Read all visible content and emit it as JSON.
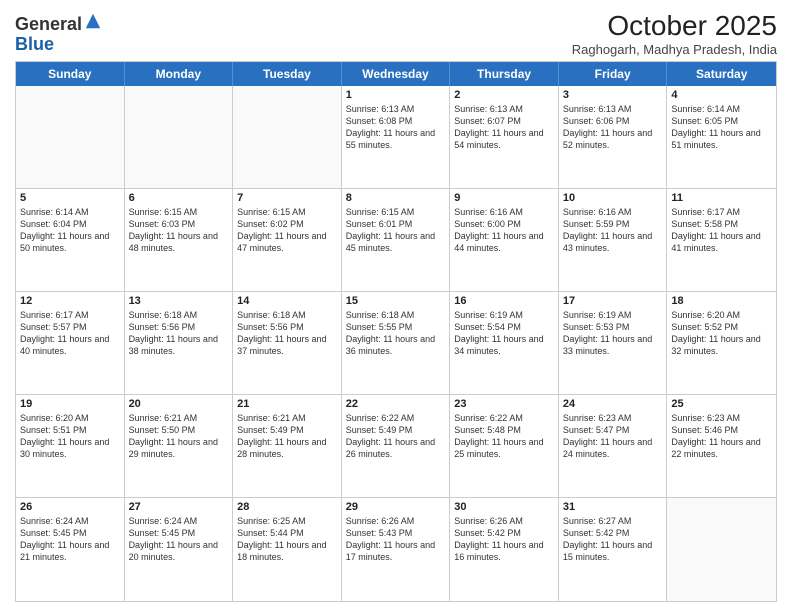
{
  "header": {
    "logo_general": "General",
    "logo_blue": "Blue",
    "month_title": "October 2025",
    "subtitle": "Raghogarh, Madhya Pradesh, India"
  },
  "calendar": {
    "days_of_week": [
      "Sunday",
      "Monday",
      "Tuesday",
      "Wednesday",
      "Thursday",
      "Friday",
      "Saturday"
    ],
    "weeks": [
      [
        {
          "day": "",
          "empty": true
        },
        {
          "day": "",
          "empty": true
        },
        {
          "day": "",
          "empty": true
        },
        {
          "day": "1",
          "sunrise": "6:13 AM",
          "sunset": "6:08 PM",
          "daylight": "11 hours and 55 minutes."
        },
        {
          "day": "2",
          "sunrise": "6:13 AM",
          "sunset": "6:07 PM",
          "daylight": "11 hours and 54 minutes."
        },
        {
          "day": "3",
          "sunrise": "6:13 AM",
          "sunset": "6:06 PM",
          "daylight": "11 hours and 52 minutes."
        },
        {
          "day": "4",
          "sunrise": "6:14 AM",
          "sunset": "6:05 PM",
          "daylight": "11 hours and 51 minutes."
        }
      ],
      [
        {
          "day": "5",
          "sunrise": "6:14 AM",
          "sunset": "6:04 PM",
          "daylight": "11 hours and 50 minutes."
        },
        {
          "day": "6",
          "sunrise": "6:15 AM",
          "sunset": "6:03 PM",
          "daylight": "11 hours and 48 minutes."
        },
        {
          "day": "7",
          "sunrise": "6:15 AM",
          "sunset": "6:02 PM",
          "daylight": "11 hours and 47 minutes."
        },
        {
          "day": "8",
          "sunrise": "6:15 AM",
          "sunset": "6:01 PM",
          "daylight": "11 hours and 45 minutes."
        },
        {
          "day": "9",
          "sunrise": "6:16 AM",
          "sunset": "6:00 PM",
          "daylight": "11 hours and 44 minutes."
        },
        {
          "day": "10",
          "sunrise": "6:16 AM",
          "sunset": "5:59 PM",
          "daylight": "11 hours and 43 minutes."
        },
        {
          "day": "11",
          "sunrise": "6:17 AM",
          "sunset": "5:58 PM",
          "daylight": "11 hours and 41 minutes."
        }
      ],
      [
        {
          "day": "12",
          "sunrise": "6:17 AM",
          "sunset": "5:57 PM",
          "daylight": "11 hours and 40 minutes."
        },
        {
          "day": "13",
          "sunrise": "6:18 AM",
          "sunset": "5:56 PM",
          "daylight": "11 hours and 38 minutes."
        },
        {
          "day": "14",
          "sunrise": "6:18 AM",
          "sunset": "5:56 PM",
          "daylight": "11 hours and 37 minutes."
        },
        {
          "day": "15",
          "sunrise": "6:18 AM",
          "sunset": "5:55 PM",
          "daylight": "11 hours and 36 minutes."
        },
        {
          "day": "16",
          "sunrise": "6:19 AM",
          "sunset": "5:54 PM",
          "daylight": "11 hours and 34 minutes."
        },
        {
          "day": "17",
          "sunrise": "6:19 AM",
          "sunset": "5:53 PM",
          "daylight": "11 hours and 33 minutes."
        },
        {
          "day": "18",
          "sunrise": "6:20 AM",
          "sunset": "5:52 PM",
          "daylight": "11 hours and 32 minutes."
        }
      ],
      [
        {
          "day": "19",
          "sunrise": "6:20 AM",
          "sunset": "5:51 PM",
          "daylight": "11 hours and 30 minutes."
        },
        {
          "day": "20",
          "sunrise": "6:21 AM",
          "sunset": "5:50 PM",
          "daylight": "11 hours and 29 minutes."
        },
        {
          "day": "21",
          "sunrise": "6:21 AM",
          "sunset": "5:49 PM",
          "daylight": "11 hours and 28 minutes."
        },
        {
          "day": "22",
          "sunrise": "6:22 AM",
          "sunset": "5:49 PM",
          "daylight": "11 hours and 26 minutes."
        },
        {
          "day": "23",
          "sunrise": "6:22 AM",
          "sunset": "5:48 PM",
          "daylight": "11 hours and 25 minutes."
        },
        {
          "day": "24",
          "sunrise": "6:23 AM",
          "sunset": "5:47 PM",
          "daylight": "11 hours and 24 minutes."
        },
        {
          "day": "25",
          "sunrise": "6:23 AM",
          "sunset": "5:46 PM",
          "daylight": "11 hours and 22 minutes."
        }
      ],
      [
        {
          "day": "26",
          "sunrise": "6:24 AM",
          "sunset": "5:45 PM",
          "daylight": "11 hours and 21 minutes."
        },
        {
          "day": "27",
          "sunrise": "6:24 AM",
          "sunset": "5:45 PM",
          "daylight": "11 hours and 20 minutes."
        },
        {
          "day": "28",
          "sunrise": "6:25 AM",
          "sunset": "5:44 PM",
          "daylight": "11 hours and 18 minutes."
        },
        {
          "day": "29",
          "sunrise": "6:26 AM",
          "sunset": "5:43 PM",
          "daylight": "11 hours and 17 minutes."
        },
        {
          "day": "30",
          "sunrise": "6:26 AM",
          "sunset": "5:42 PM",
          "daylight": "11 hours and 16 minutes."
        },
        {
          "day": "31",
          "sunrise": "6:27 AM",
          "sunset": "5:42 PM",
          "daylight": "11 hours and 15 minutes."
        },
        {
          "day": "",
          "empty": true
        }
      ]
    ]
  }
}
